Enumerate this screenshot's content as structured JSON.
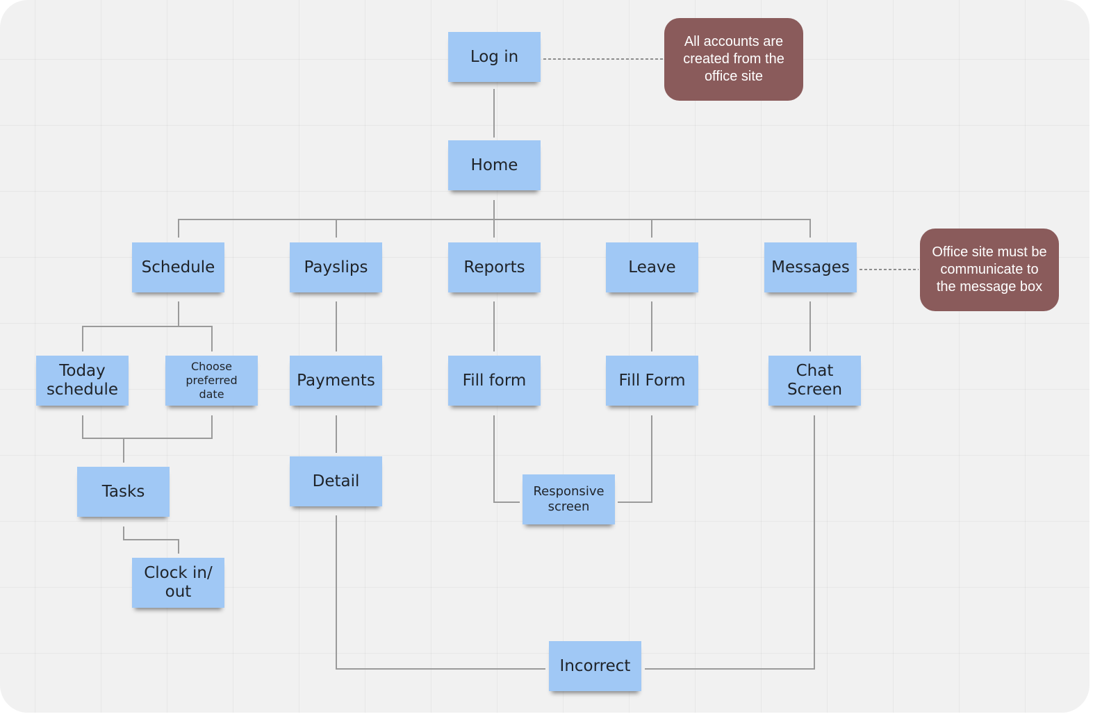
{
  "diagram": {
    "type": "sitemap-flowchart",
    "nodes": {
      "login": "Log in",
      "home": "Home",
      "schedule": "Schedule",
      "payslips": "Payslips",
      "reports": "Reports",
      "leave": "Leave",
      "messages": "Messages",
      "today_schedule": "Today schedule",
      "choose_preferred_date": "Choose preferred date",
      "payments": "Payments",
      "fill_form_reports": "Fill form",
      "fill_form_leave": "Fill Form",
      "chat_screen": "Chat Screen",
      "tasks": "Tasks",
      "detail": "Detail",
      "responsive_screen": "Responsive screen",
      "clock_in_out": "Clock in/ out",
      "incorrect": "Incorrect"
    },
    "notes": {
      "login_note": "All accounts are created from the office site",
      "messages_note": "Office site must be communicate to the message box"
    },
    "edges": [
      [
        "login",
        "home"
      ],
      [
        "home",
        "schedule"
      ],
      [
        "home",
        "payslips"
      ],
      [
        "home",
        "reports"
      ],
      [
        "home",
        "leave"
      ],
      [
        "home",
        "messages"
      ],
      [
        "schedule",
        "today_schedule"
      ],
      [
        "schedule",
        "choose_preferred_date"
      ],
      [
        "today_schedule",
        "tasks"
      ],
      [
        "choose_preferred_date",
        "tasks"
      ],
      [
        "tasks",
        "clock_in_out"
      ],
      [
        "payslips",
        "payments"
      ],
      [
        "payments",
        "detail"
      ],
      [
        "reports",
        "fill_form_reports"
      ],
      [
        "leave",
        "fill_form_leave"
      ],
      [
        "fill_form_reports",
        "responsive_screen"
      ],
      [
        "fill_form_leave",
        "responsive_screen"
      ],
      [
        "messages",
        "chat_screen"
      ],
      [
        "detail",
        "incorrect"
      ],
      [
        "chat_screen",
        "incorrect"
      ]
    ],
    "note_links": [
      [
        "login",
        "login_note"
      ],
      [
        "messages",
        "messages_note"
      ]
    ],
    "colors": {
      "node_fill": "#a0c8f5",
      "note_fill": "#8a5b5b",
      "connector": "#9a9a9a",
      "canvas": "#f1f1f1"
    }
  }
}
